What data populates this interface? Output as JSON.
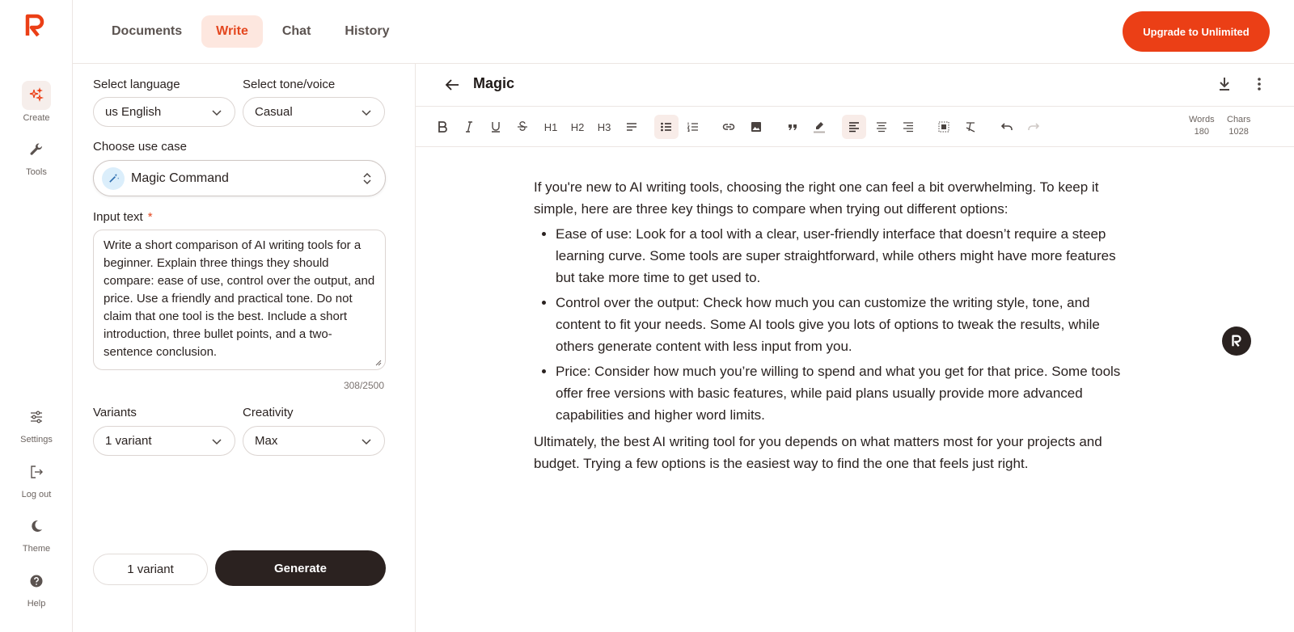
{
  "colors": {
    "accent": "#eb3f16",
    "tab_active_bg": "#fde7df",
    "dark": "#2b2220"
  },
  "app": {
    "logo_icon": "r-logo-icon"
  },
  "rail": {
    "top_items": [
      {
        "label": "Create",
        "icon": "sparkles-icon"
      },
      {
        "label": "Tools",
        "icon": "wrench-icon"
      }
    ],
    "bottom_items": [
      {
        "label": "Settings",
        "icon": "sliders-icon"
      },
      {
        "label": "Log out",
        "icon": "logout-icon"
      },
      {
        "label": "Theme",
        "icon": "moon-icon"
      },
      {
        "label": "Help",
        "icon": "help-icon"
      }
    ]
  },
  "header": {
    "tabs": [
      {
        "label": "Documents",
        "active": false
      },
      {
        "label": "Write",
        "active": true
      },
      {
        "label": "Chat",
        "active": false
      },
      {
        "label": "History",
        "active": false
      }
    ],
    "upgrade_label": "Upgrade to Unlimited"
  },
  "form": {
    "language_label": "Select language",
    "language_value": "us English",
    "tone_label": "Select tone/voice",
    "tone_value": "Casual",
    "usecase_label": "Choose use case",
    "usecase_value": "Magic Command",
    "input_label": "Input text",
    "required_mark": "*",
    "input_text": "Write a short comparison of AI writing tools for a beginner. Explain three things they should compare: ease of use, control over the output, and price. Use a friendly and practical tone. Do not claim that one tool is the best. Include a short introduction, three bullet points, and a two-sentence conclusion.",
    "counter": "308/2500",
    "variants_label": "Variants",
    "variants_value": "1 variant",
    "creativity_label": "Creativity",
    "creativity_value": "Max",
    "bottom_variant_label": "1 variant",
    "generate_label": "Generate"
  },
  "editor": {
    "title": "Magic",
    "toolbar": {
      "h1": "H1",
      "h2": "H2",
      "h3": "H3"
    },
    "stats": {
      "words_label": "Words",
      "words_value": "180",
      "chars_label": "Chars",
      "chars_value": "1028"
    },
    "intro": "If you're new to AI writing tools, choosing the right one can feel a bit overwhelming. To keep it simple, here are three key things to compare when trying out different options:",
    "bullets": [
      "Ease of use: Look for a tool with a clear, user-friendly interface that doesn’t require a steep learning curve. Some tools are super straightforward, while others might have more features but take more time to get used to.",
      "Control over the output: Check how much you can customize the writing style, tone, and content to fit your needs. Some AI tools give you lots of options to tweak the results, while others generate content with less input from you.",
      "Price: Consider how much you’re willing to spend and what you get for that price. Some tools offer free versions with basic features, while paid plans usually provide more advanced capabilities and higher word limits."
    ],
    "conclusion": "Ultimately, the best AI writing tool for you depends on what matters most for your projects and budget. Trying a few options is the easiest way to find the one that feels just right."
  }
}
